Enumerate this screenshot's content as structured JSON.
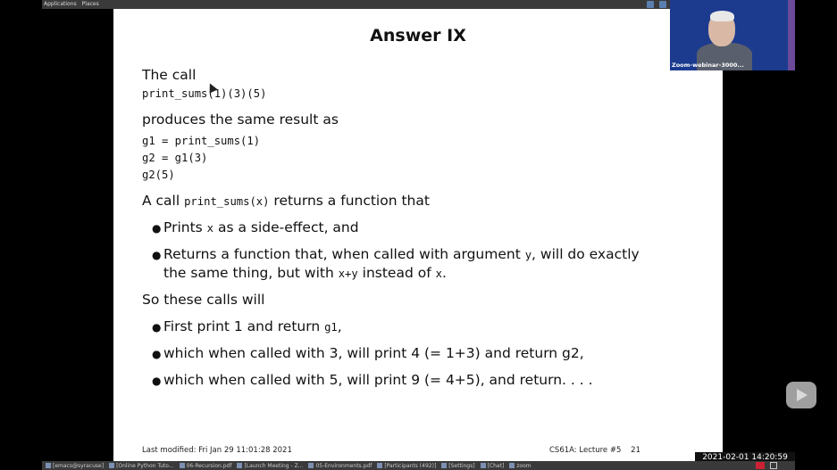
{
  "topbar": {
    "applications_label": "Applications",
    "places_label": "Places"
  },
  "slide": {
    "title": "Answer IX",
    "call_label": "The call",
    "call_code": "print_sums(1)(3)(5)",
    "produces_label": "produces the same result as",
    "code_lines": [
      "g1 = print_sums(1)",
      "g2 = g1(3)",
      "g2(5)"
    ],
    "returns_pre": "A call ",
    "returns_code": "print_sums(x)",
    "returns_post": " returns a function that",
    "bullet1_pre": "Prints ",
    "bullet1_code": "x",
    "bullet1_post": " as a side-effect, and",
    "bullet2_line1_pre": "Returns a function that, when called with argument ",
    "bullet2_line1_code": "y",
    "bullet2_line1_post": ", will do exactly",
    "bullet2_line2_pre": "the same thing, but with ",
    "bullet2_line2_code": "x+y",
    "bullet2_line2_mid": " instead of ",
    "bullet2_line2_code2": "x",
    "bullet2_line2_post": ".",
    "so_label": "So these calls will",
    "bullet3_pre": "First print 1 and return ",
    "bullet3_code": "g1",
    "bullet3_post": ",",
    "bullet4": "which when called with 3, will print 4 (= 1+3) and return g2,",
    "bullet5": "which when called with 5, will print 9 (= 4+5), and return. . . .",
    "footer_left": "Last modified: Fri Jan 29 11:01:28 2021",
    "footer_right": "CS61A: Lecture #5    21"
  },
  "webcam": {
    "label": "Zoom-webinar-3000..."
  },
  "clock": "2021-02-01  14:20:59",
  "taskbar": {
    "items": [
      "[emacs@syracuse]",
      "[Online Python Tuto...",
      "06-Recursion.pdf",
      "[Launch Meeting - Z...",
      "05-Environments.pdf",
      "[Participants (492)]",
      "[Settings]",
      "[Chat]",
      "zoom"
    ]
  }
}
